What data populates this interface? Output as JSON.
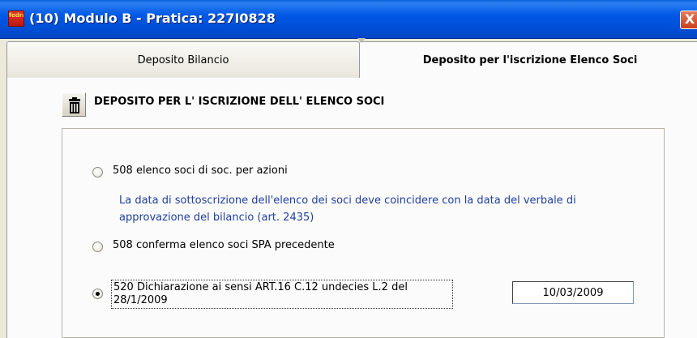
{
  "window": {
    "title": "(10) Modulo B - Pratica: 227I0828",
    "app_icon": "app-logo-icon",
    "app_icon_text": "fedra",
    "close_symbol": "X"
  },
  "tabs": [
    {
      "label": "Deposito Bilancio",
      "active": false
    },
    {
      "label": "Deposito per l'iscrizione Elenco Soci",
      "active": true
    }
  ],
  "section": {
    "title": "DEPOSITO PER L' ISCRIZIONE DELL' ELENCO SOCI",
    "delete_icon": "trash-icon"
  },
  "options": [
    {
      "label": "508 elenco soci di soc. per azioni",
      "checked": false
    },
    {
      "label": "508 conferma elenco soci SPA precedente",
      "checked": false
    },
    {
      "label": "520 Dichiarazione ai sensi ART.16 C.12 undecies L.2 del 28/1/2009",
      "checked": true
    }
  ],
  "note": {
    "line1": "La data di sottoscrizione dell'elenco dei soci deve coincidere con la data del verbale di",
    "line2": "approvazione del bilancio (art. 2435)"
  },
  "date_field": {
    "value": "10/03/2009"
  },
  "colors": {
    "titlebar": "#0058e6",
    "note_text": "#1f3f9c",
    "panel_bg": "#fbfbfb",
    "window_bg": "#ece9d8"
  }
}
